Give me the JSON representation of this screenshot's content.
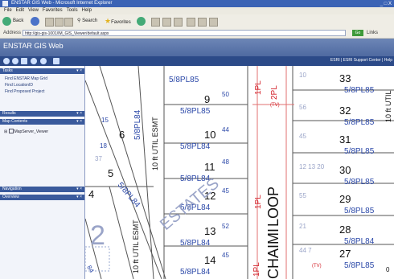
{
  "window": {
    "title": "ENSTAR GIS Web - Microsoft Internet Explorer",
    "controls": "_ □ X"
  },
  "menu": [
    "File",
    "Edit",
    "View",
    "Favorites",
    "Tools",
    "Help"
  ],
  "toolbar": {
    "back": "Back",
    "search": "Search",
    "favorites": "Favorites"
  },
  "address": {
    "label": "Address",
    "url": "http://gis-gis-1001/IM_GIS_Viewer/default.aspx",
    "go": "Go",
    "links": "Links"
  },
  "app": {
    "title": "ENSTAR GIS Web",
    "header_links": "ESRI | ESRI Support Center | Help"
  },
  "panel": {
    "tasks": {
      "title": "Tasks",
      "items": [
        "Find ENSTAR Map Grid",
        "Find LocationID",
        "Find Proposed Project"
      ]
    },
    "results": {
      "title": "Results"
    },
    "toc": {
      "title": "Map Contents",
      "layer": "MapServer_Viewer"
    },
    "navigation": {
      "title": "Navigation"
    },
    "overview": {
      "title": "Overview"
    },
    "panel_controls": "▾ ×"
  },
  "map": {
    "lots": [
      {
        "num": "9",
        "code": "5/8PL85",
        "dim": "50"
      },
      {
        "num": "10",
        "code": "5/8PL84",
        "dim": "44"
      },
      {
        "num": "11",
        "code": "5/8PL84",
        "dim": "48"
      },
      {
        "num": "12",
        "code": "5/8PL84",
        "dim": "45"
      },
      {
        "num": "13",
        "code": "5/8PL84",
        "dim": "52"
      },
      {
        "num": "14",
        "code": "5/8PL84",
        "dim": "45"
      },
      {
        "num": "6",
        "code": "5/8PL84",
        "dim": "15"
      },
      {
        "num": "5",
        "code": "",
        "dim": "37"
      },
      {
        "num": "4",
        "code": "5/8PL84",
        "dim": "18"
      },
      {
        "num": "2",
        "code": "",
        "dim": ""
      }
    ],
    "right_lots": [
      {
        "num": "33",
        "code": "5/8PL85",
        "dim": "10"
      },
      {
        "num": "32",
        "code": "5/8PL85",
        "dim": "56"
      },
      {
        "num": "31",
        "code": "5/8PL85",
        "dim": "45"
      },
      {
        "num": "30",
        "code": "5/8PL85",
        "dim": "12 13 20"
      },
      {
        "num": "29",
        "code": "5/8PL85",
        "dim": "55"
      },
      {
        "num": "28",
        "code": "5/8PL84",
        "dim": "21"
      },
      {
        "num": "27",
        "code": "5/8PL85",
        "dim": "44 7"
      }
    ],
    "streets": [
      "LOOP",
      "CHAIMI"
    ],
    "estates": "ESTATES",
    "esmt_labels": [
      "10 ft UTIL ESMT",
      "10 ft UTIL ESMT",
      "10 ft UTIL"
    ],
    "pl_labels": [
      "1PL",
      "2PL",
      "1PL",
      "1PL"
    ],
    "tiny": [
      "(TV)",
      "(TV)"
    ],
    "misc": [
      "5/8PL85",
      "84",
      "0"
    ]
  }
}
